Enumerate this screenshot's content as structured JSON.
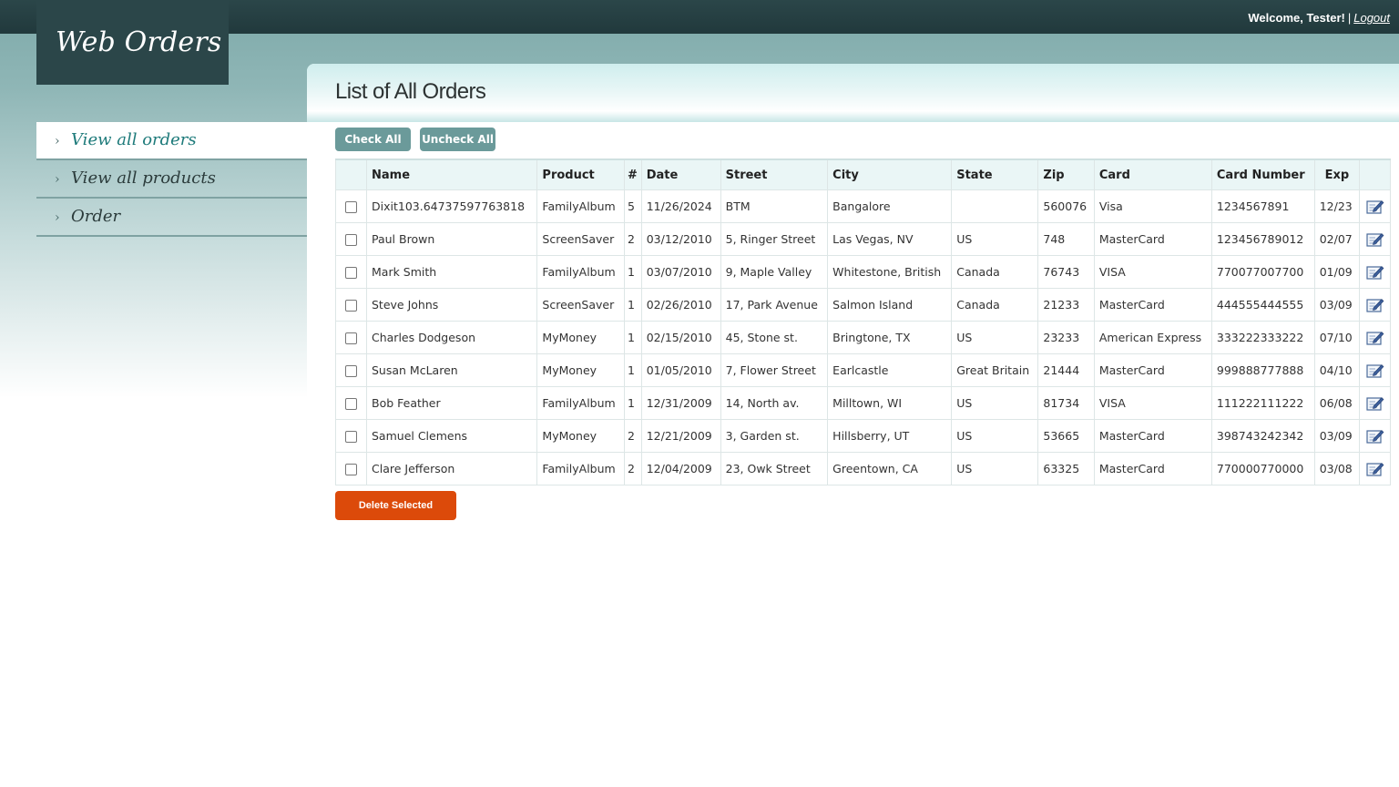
{
  "app": {
    "logo": "Web Orders",
    "welcome": "Welcome, Tester!",
    "separator": "|",
    "logout": "Logout"
  },
  "nav": {
    "items": [
      {
        "label": "View all orders",
        "active": true
      },
      {
        "label": "View all products",
        "active": false
      },
      {
        "label": "Order",
        "active": false
      }
    ]
  },
  "main": {
    "title": "List of All Orders",
    "check_all": "Check All",
    "uncheck_all": "Uncheck All",
    "delete_selected": "Delete Selected",
    "columns": [
      "Name",
      "Product",
      "#",
      "Date",
      "Street",
      "City",
      "State",
      "Zip",
      "Card",
      "Card Number",
      "Exp"
    ],
    "rows": [
      {
        "name": "Dixit103.64737597763818",
        "product": "FamilyAlbum",
        "qty": "5",
        "date": "11/26/2024",
        "street": "BTM",
        "city": "Bangalore",
        "state": "",
        "zip": "560076",
        "card": "Visa",
        "card_number": "1234567891",
        "exp": "12/23"
      },
      {
        "name": "Paul Brown",
        "product": "ScreenSaver",
        "qty": "2",
        "date": "03/12/2010",
        "street": "5, Ringer Street",
        "city": "Las Vegas, NV",
        "state": "US",
        "zip": "748",
        "card": "MasterCard",
        "card_number": "123456789012",
        "exp": "02/07"
      },
      {
        "name": "Mark Smith",
        "product": "FamilyAlbum",
        "qty": "1",
        "date": "03/07/2010",
        "street": "9, Maple Valley",
        "city": "Whitestone, British",
        "state": "Canada",
        "zip": "76743",
        "card": "VISA",
        "card_number": "770077007700",
        "exp": "01/09"
      },
      {
        "name": "Steve Johns",
        "product": "ScreenSaver",
        "qty": "1",
        "date": "02/26/2010",
        "street": "17, Park Avenue",
        "city": "Salmon Island",
        "state": "Canada",
        "zip": "21233",
        "card": "MasterCard",
        "card_number": "444555444555",
        "exp": "03/09"
      },
      {
        "name": "Charles Dodgeson",
        "product": "MyMoney",
        "qty": "1",
        "date": "02/15/2010",
        "street": "45, Stone st.",
        "city": "Bringtone, TX",
        "state": "US",
        "zip": "23233",
        "card": "American Express",
        "card_number": "333222333222",
        "exp": "07/10"
      },
      {
        "name": "Susan McLaren",
        "product": "MyMoney",
        "qty": "1",
        "date": "01/05/2010",
        "street": "7, Flower Street",
        "city": "Earlcastle",
        "state": "Great Britain",
        "zip": "21444",
        "card": "MasterCard",
        "card_number": "999888777888",
        "exp": "04/10"
      },
      {
        "name": "Bob Feather",
        "product": "FamilyAlbum",
        "qty": "1",
        "date": "12/31/2009",
        "street": "14, North av.",
        "city": "Milltown, WI",
        "state": "US",
        "zip": "81734",
        "card": "VISA",
        "card_number": "111222111222",
        "exp": "06/08"
      },
      {
        "name": "Samuel Clemens",
        "product": "MyMoney",
        "qty": "2",
        "date": "12/21/2009",
        "street": "3, Garden st.",
        "city": "Hillsberry, UT",
        "state": "US",
        "zip": "53665",
        "card": "MasterCard",
        "card_number": "398743242342",
        "exp": "03/09"
      },
      {
        "name": "Clare Jefferson",
        "product": "FamilyAlbum",
        "qty": "2",
        "date": "12/04/2009",
        "street": "23, Owk Street",
        "city": "Greentown, CA",
        "state": "US",
        "zip": "63325",
        "card": "MasterCard",
        "card_number": "770000770000",
        "exp": "03/08"
      }
    ]
  },
  "colors": {
    "header_dark": "#2b4649",
    "accent_teal": "#6b9a9a",
    "active_link": "#1d7a7a",
    "delete_orange": "#dc4a0a"
  },
  "icons": {
    "nav_bullet": "chevron-right-icon",
    "row_action": "edit-icon"
  }
}
